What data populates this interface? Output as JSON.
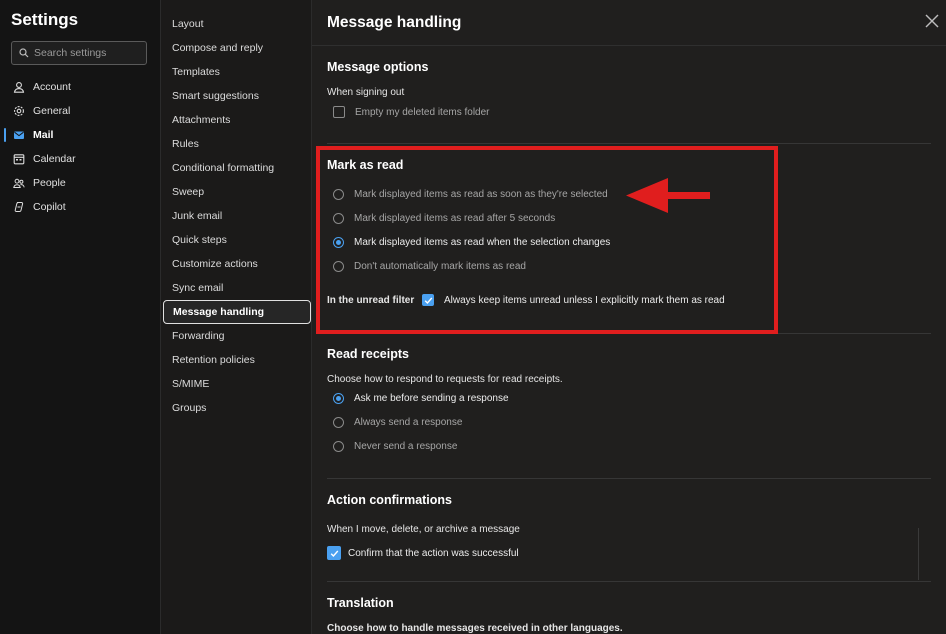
{
  "sidebar": {
    "title": "Settings",
    "search_placeholder": "Search settings",
    "items": [
      {
        "label": "Account",
        "icon": "person-icon"
      },
      {
        "label": "General",
        "icon": "gear-icon"
      },
      {
        "label": "Mail",
        "icon": "mail-icon",
        "active": true
      },
      {
        "label": "Calendar",
        "icon": "calendar-icon"
      },
      {
        "label": "People",
        "icon": "people-icon"
      },
      {
        "label": "Copilot",
        "icon": "copilot-icon"
      }
    ]
  },
  "submenu": {
    "items": [
      "Layout",
      "Compose and reply",
      "Templates",
      "Smart suggestions",
      "Attachments",
      "Rules",
      "Conditional formatting",
      "Sweep",
      "Junk email",
      "Quick steps",
      "Customize actions",
      "Sync email",
      "Message handling",
      "Forwarding",
      "Retention policies",
      "S/MIME",
      "Groups"
    ],
    "active": "Message handling"
  },
  "main": {
    "title": "Message handling",
    "message_options": {
      "title": "Message options",
      "when_signing_out": "When signing out",
      "empty_deleted": "Empty my deleted items folder"
    },
    "mark_as_read": {
      "title": "Mark as read",
      "options": [
        "Mark displayed items as read as soon as they're selected",
        "Mark displayed items as read after 5 seconds",
        "Mark displayed items as read when the selection changes",
        "Don't automatically mark items as read"
      ],
      "selected_index": 2,
      "unread_filter_label": "In the unread filter",
      "unread_filter_option": "Always keep items unread unless I explicitly mark them as read"
    },
    "read_receipts": {
      "title": "Read receipts",
      "description": "Choose how to respond to requests for read receipts.",
      "options": [
        "Ask me before sending a response",
        "Always send a response",
        "Never send a response"
      ],
      "selected_index": 0
    },
    "action_confirmations": {
      "title": "Action confirmations",
      "description": "When I move, delete, or archive a message",
      "option": "Confirm that the action was successful"
    },
    "translation": {
      "title": "Translation",
      "description": "Choose how to handle messages received in other languages."
    }
  },
  "colors": {
    "accent": "#4aa0f0",
    "highlight_box": "#e01e1e"
  }
}
